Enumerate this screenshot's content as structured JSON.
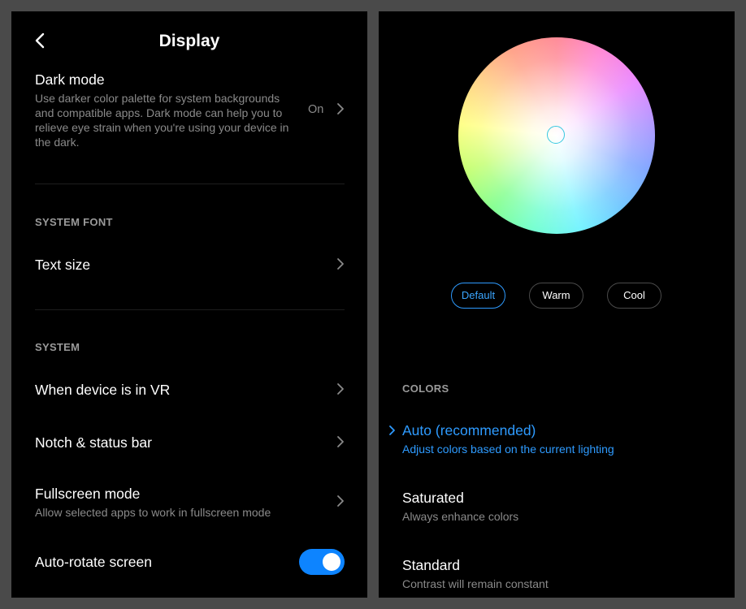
{
  "left": {
    "title": "Display",
    "dark_mode": {
      "title": "Dark mode",
      "description": "Use darker color palette for system backgrounds and compatible apps. Dark mode can help you to relieve eye strain when you're using your device in the dark.",
      "value": "On"
    },
    "system_font": {
      "header": "SYSTEM FONT",
      "text_size": "Text size"
    },
    "system": {
      "header": "SYSTEM",
      "vr": "When device is in VR",
      "notch": "Notch & status bar",
      "fullscreen": {
        "title": "Fullscreen mode",
        "description": "Allow selected apps to work in fullscreen mode"
      },
      "autorotate": {
        "title": "Auto-rotate screen",
        "enabled": true
      }
    }
  },
  "right": {
    "presets": [
      "Default",
      "Warm",
      "Cool"
    ],
    "selected_preset": "Default",
    "colors": {
      "header": "COLORS",
      "auto": {
        "title": "Auto (recommended)",
        "description": "Adjust colors based on the current lighting",
        "selected": true
      },
      "saturated": {
        "title": "Saturated",
        "description": "Always enhance colors"
      },
      "standard": {
        "title": "Standard",
        "description": "Contrast will remain constant"
      }
    }
  },
  "colors": {
    "accent": "#2e9bff",
    "toggle_on": "#0d84ff",
    "background": "#000000",
    "secondary_text": "#8a8a8a"
  }
}
